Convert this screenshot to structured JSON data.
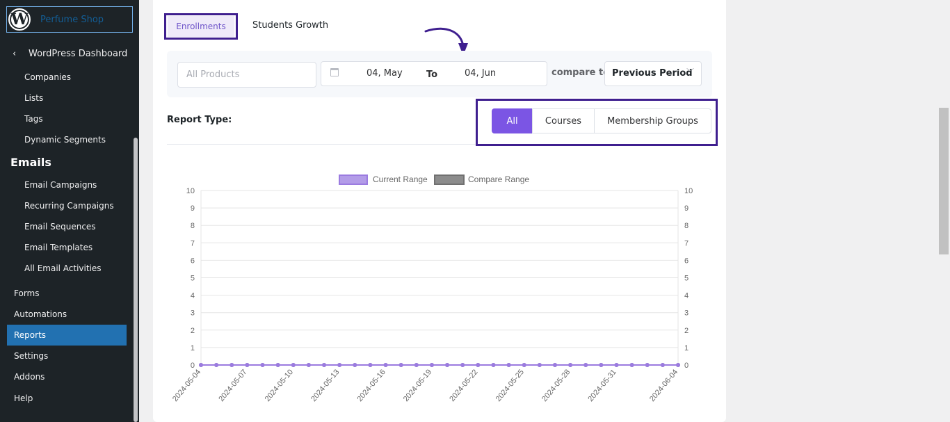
{
  "sidebar": {
    "site_name": "Perfume Shop",
    "back_label": "WordPress Dashboard",
    "crm_items": [
      "Companies",
      "Lists",
      "Tags",
      "Dynamic Segments"
    ],
    "emails_heading": "Emails",
    "email_items": [
      "Email Campaigns",
      "Recurring Campaigns",
      "Email Sequences",
      "Email Templates",
      "All Email Activities"
    ],
    "bottom_items": [
      "Forms",
      "Automations",
      "Reports",
      "Settings",
      "Addons",
      "Help"
    ],
    "active_item": "Reports"
  },
  "tabs": {
    "enrollments": "Enrollments",
    "students_growth": "Students Growth"
  },
  "filters": {
    "products_placeholder": "All Products",
    "date_start": "04, May",
    "date_to": "To",
    "date_end": "04, Jun",
    "compare_label": "compare to",
    "compare_value": "Previous Period"
  },
  "report_type": {
    "label": "Report Type:",
    "options": [
      "All",
      "Courses",
      "Membership Groups"
    ],
    "selected": "All"
  },
  "colors": {
    "accent": "#7b55e4",
    "current_range": "#9b7be0",
    "compare_range": "#808080",
    "highlight_box": "#3f1f8f"
  },
  "chart_data": {
    "type": "line",
    "title": "",
    "xlabel": "",
    "ylabel": "",
    "ylim": [
      0,
      10
    ],
    "y_ticks": [
      0,
      1,
      2,
      3,
      4,
      5,
      6,
      7,
      8,
      9,
      10
    ],
    "legend": "top-center",
    "x_tick_labels": [
      "2024-05-04",
      "2024-05-07",
      "2024-05-10",
      "2024-05-13",
      "2024-05-16",
      "2024-05-19",
      "2024-05-22",
      "2024-05-25",
      "2024-05-28",
      "2024-05-31",
      "2024-06-04"
    ],
    "x": [
      "2024-05-04",
      "2024-05-05",
      "2024-05-06",
      "2024-05-07",
      "2024-05-08",
      "2024-05-09",
      "2024-05-10",
      "2024-05-11",
      "2024-05-12",
      "2024-05-13",
      "2024-05-14",
      "2024-05-15",
      "2024-05-16",
      "2024-05-17",
      "2024-05-18",
      "2024-05-19",
      "2024-05-20",
      "2024-05-21",
      "2024-05-22",
      "2024-05-23",
      "2024-05-24",
      "2024-05-25",
      "2024-05-26",
      "2024-05-27",
      "2024-05-28",
      "2024-05-29",
      "2024-05-30",
      "2024-05-31",
      "2024-06-01",
      "2024-06-02",
      "2024-06-03",
      "2024-06-04"
    ],
    "series": [
      {
        "name": "Current Range",
        "values": [
          0,
          0,
          0,
          0,
          0,
          0,
          0,
          0,
          0,
          0,
          0,
          0,
          0,
          0,
          0,
          0,
          0,
          0,
          0,
          0,
          0,
          0,
          0,
          0,
          0,
          0,
          0,
          0,
          0,
          0,
          0,
          0
        ]
      },
      {
        "name": "Compare Range",
        "values": [
          0,
          0,
          0,
          0,
          0,
          0,
          0,
          0,
          0,
          0,
          0,
          0,
          0,
          0,
          0,
          0,
          0,
          0,
          0,
          0,
          0,
          0,
          0,
          0,
          0,
          0,
          0,
          0,
          0,
          0,
          0,
          0
        ]
      }
    ]
  }
}
